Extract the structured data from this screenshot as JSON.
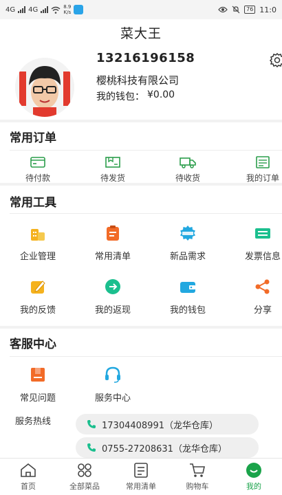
{
  "status_bar": {
    "carrier_1": "4G",
    "carrier_2": "4G",
    "net_speed": "8.9",
    "net_unit": "K/s",
    "battery": "76",
    "time": "11:0"
  },
  "header": {
    "title": "菜大王"
  },
  "profile": {
    "phone": "13216196158",
    "company": "樱桃科技有限公司",
    "wallet_label": "我的钱包：",
    "wallet_amount": "¥0.00"
  },
  "orders": {
    "title": "常用订单",
    "items": [
      {
        "label": "待付款",
        "icon": "card-icon"
      },
      {
        "label": "待发货",
        "icon": "box-icon"
      },
      {
        "label": "待收货",
        "icon": "truck-icon"
      },
      {
        "label": "我的订单",
        "icon": "receipt-icon"
      }
    ]
  },
  "tools": {
    "title": "常用工具",
    "items": [
      {
        "label": "企业管理",
        "icon": "enterprise-icon",
        "color": "#f5b21e"
      },
      {
        "label": "常用清单",
        "icon": "clipboard-icon",
        "color": "#f26b28"
      },
      {
        "label": "新品需求",
        "icon": "new-badge-icon",
        "color": "#22a8e0"
      },
      {
        "label": "发票信息",
        "icon": "invoice-icon",
        "color": "#1bbf8e"
      },
      {
        "label": "我的反馈",
        "icon": "feedback-icon",
        "color": "#f5b21e"
      },
      {
        "label": "我的返现",
        "icon": "cashback-icon",
        "color": "#1bbf8e"
      },
      {
        "label": "我的钱包",
        "icon": "wallet-icon",
        "color": "#22a8e0"
      },
      {
        "label": "分享",
        "icon": "share-icon",
        "color": "#f26b28"
      }
    ]
  },
  "service": {
    "title": "客服中心",
    "items": [
      {
        "label": "常见问题",
        "icon": "faq-icon",
        "color": "#f26b28"
      },
      {
        "label": "服务中心",
        "icon": "headset-icon",
        "color": "#22a8e0"
      }
    ],
    "hotline_label": "服务热线",
    "hotlines": [
      "17304408991（龙华仓库）",
      "0755-27208631（龙华仓库）"
    ]
  },
  "tabbar": {
    "items": [
      {
        "label": "首页",
        "icon": "home-icon"
      },
      {
        "label": "全部菜品",
        "icon": "grid-icon"
      },
      {
        "label": "常用清单",
        "icon": "list-icon"
      },
      {
        "label": "购物车",
        "icon": "cart-icon"
      },
      {
        "label": "我的",
        "icon": "profile-icon"
      }
    ],
    "active_color": "#1aa34a"
  }
}
